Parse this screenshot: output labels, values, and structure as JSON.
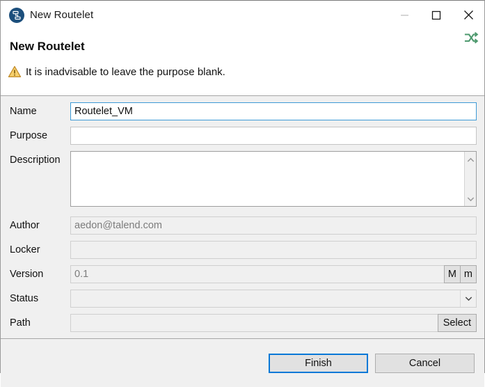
{
  "window": {
    "title": "New Routelet",
    "icon": "routelet-icon",
    "controls": {
      "minimize": "minimize-icon",
      "maximize": "maximize-icon",
      "close": "close-icon"
    }
  },
  "header": {
    "title": "New Routelet",
    "warning_icon": "warning-triangle-icon",
    "warning_text": "It is inadvisable to leave the purpose blank.",
    "decor_icon": "shuffle-icon",
    "decor_icon_color": "#4f9a6f"
  },
  "form": {
    "name": {
      "label": "Name",
      "value": "Routelet_VM",
      "placeholder": "",
      "focused": true,
      "disabled": false
    },
    "purpose": {
      "label": "Purpose",
      "value": "",
      "placeholder": "",
      "focused": false,
      "disabled": false
    },
    "description": {
      "label": "Description",
      "value": "",
      "placeholder": ""
    },
    "author": {
      "label": "Author",
      "value": "aedon@talend.com",
      "disabled": true
    },
    "locker": {
      "label": "Locker",
      "value": "",
      "disabled": true
    },
    "version": {
      "label": "Version",
      "value": "0.1",
      "disabled": true,
      "major_button": "M",
      "minor_button": "m"
    },
    "status": {
      "label": "Status",
      "value": "",
      "arrow_icon": "chevron-down-icon"
    },
    "path": {
      "label": "Path",
      "value": "",
      "select_button": "Select"
    }
  },
  "footer": {
    "finish_label": "Finish",
    "cancel_label": "Cancel",
    "accent": "#0078d7"
  }
}
